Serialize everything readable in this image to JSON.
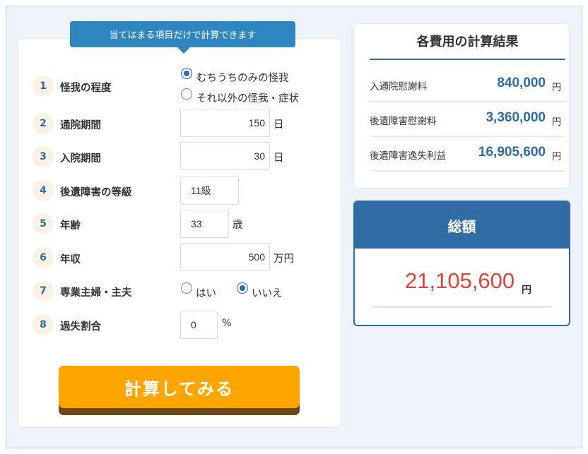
{
  "banner": {
    "text": "当てはまる項目だけで計算できます"
  },
  "rows": [
    {
      "num": "1",
      "label": "怪我の程度"
    },
    {
      "num": "2",
      "label": "通院期間"
    },
    {
      "num": "3",
      "label": "入院期間"
    },
    {
      "num": "4",
      "label": "後遺障害の等級"
    },
    {
      "num": "5",
      "label": "年齢"
    },
    {
      "num": "6",
      "label": "年収"
    },
    {
      "num": "7",
      "label": "専業主婦・主夫"
    },
    {
      "num": "8",
      "label": "過失割合"
    }
  ],
  "injury": {
    "options": [
      {
        "label": "むちうちのみの怪我",
        "checked": true
      },
      {
        "label": "それ以外の怪我・症状",
        "checked": false
      }
    ]
  },
  "outpatient": {
    "value": "150",
    "unit": "日"
  },
  "inpatient": {
    "value": "30",
    "unit": "日"
  },
  "disability_grade": {
    "value": "11級"
  },
  "age": {
    "value": "33",
    "unit": "歳"
  },
  "income": {
    "value": "500",
    "unit": "万円"
  },
  "housewife": {
    "options": [
      {
        "label": "はい",
        "checked": false
      },
      {
        "label": "いいえ",
        "checked": true
      }
    ]
  },
  "fault": {
    "value": "0",
    "unit": "%"
  },
  "calc_button": {
    "label": "計算してみる"
  },
  "results": {
    "title": "各費用の計算結果",
    "items": [
      {
        "name": "入通院慰謝料",
        "value": "840,000",
        "unit": "円"
      },
      {
        "name": "後遺障害慰謝料",
        "value": "3,360,000",
        "unit": "円"
      },
      {
        "name": "後遺障害逸失利益",
        "value": "16,905,600",
        "unit": "円"
      }
    ]
  },
  "total": {
    "title": "総額",
    "value": "21,105,600",
    "unit": "円"
  },
  "colors": {
    "accent_blue": "#2e6ca3",
    "banner_blue": "#2e86c1",
    "button_orange": "#ffa500",
    "total_red": "#d9453a"
  }
}
